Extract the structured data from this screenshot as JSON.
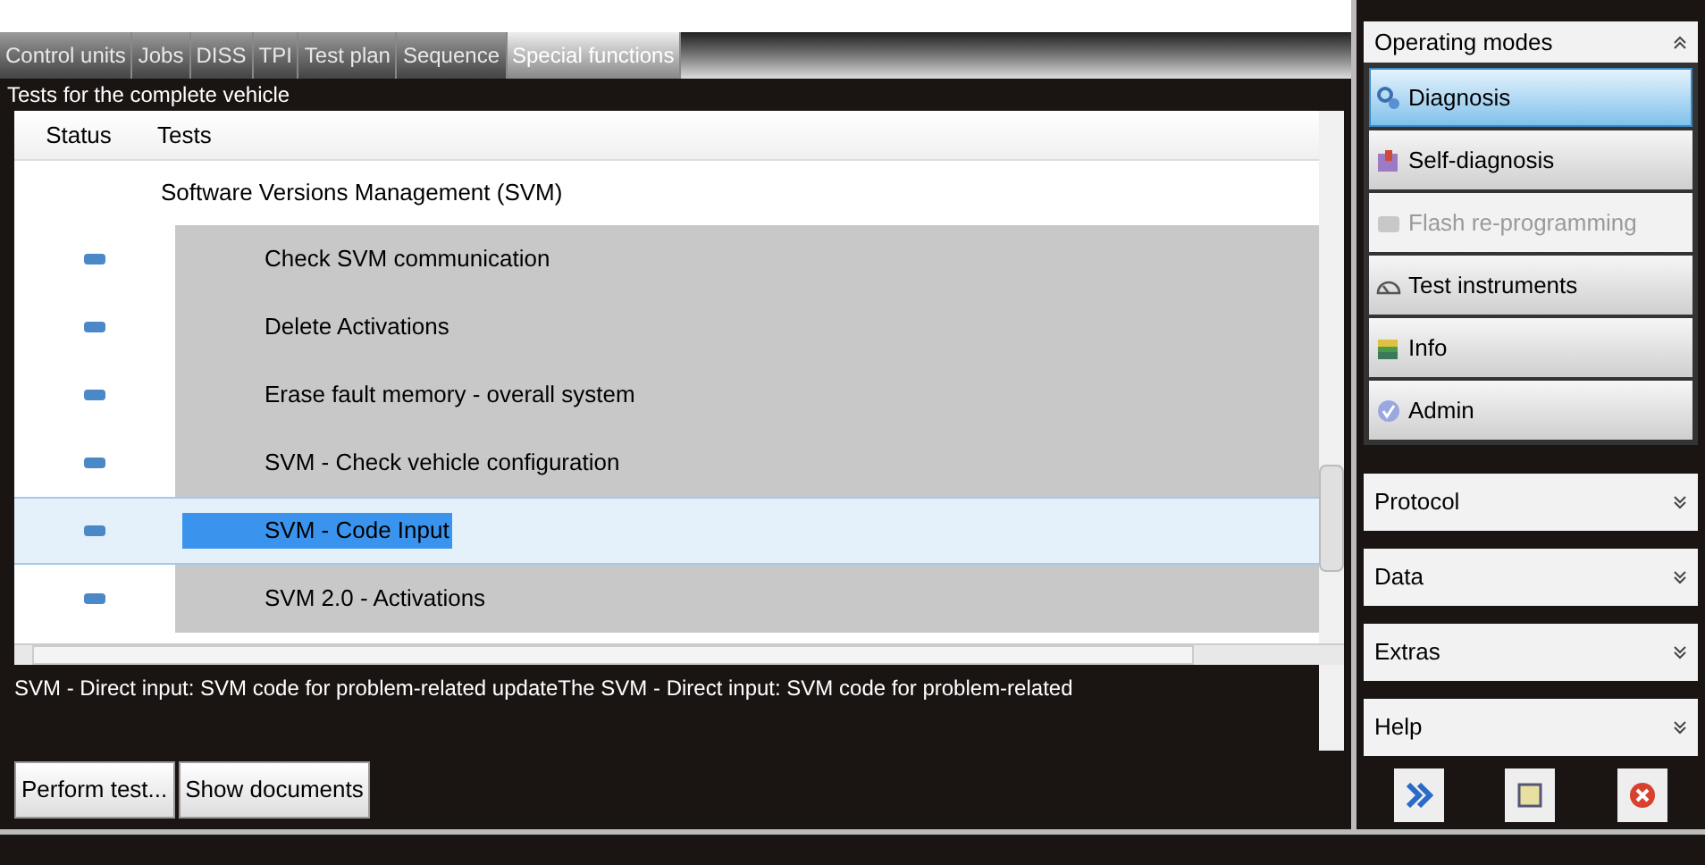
{
  "tabs": [
    {
      "label": "Control units",
      "selected": false
    },
    {
      "label": "Jobs",
      "selected": false
    },
    {
      "label": "DISS",
      "selected": false
    },
    {
      "label": "TPI",
      "selected": false
    },
    {
      "label": "Test plan",
      "selected": false
    },
    {
      "label": "Sequence",
      "selected": false
    },
    {
      "label": "Special functions",
      "selected": true
    }
  ],
  "section_title": "Tests for the complete vehicle",
  "table": {
    "columns": [
      "Status",
      "Tests"
    ],
    "group": "Software Versions Management (SVM)",
    "rows": [
      {
        "test": "Check SVM communication",
        "selected": false
      },
      {
        "test": "Delete Activations",
        "selected": false
      },
      {
        "test": "Erase fault memory - overall system",
        "selected": false
      },
      {
        "test": "SVM - Check vehicle configuration",
        "selected": false
      },
      {
        "test": "SVM - Code Input",
        "selected": true
      },
      {
        "test": "SVM 2.0 - Activations",
        "selected": false
      }
    ]
  },
  "description": "SVM - Direct input: SVM code for problem-related updateThe SVM - Direct input: SVM code for problem-related",
  "buttons": [
    "Perform test...",
    "Show documents"
  ],
  "sidebar": {
    "header": "Operating modes",
    "modes": [
      {
        "label": "Diagnosis",
        "kind": "stethoscope",
        "selected": true,
        "disabled": false
      },
      {
        "label": "Self-diagnosis",
        "kind": "car",
        "selected": false,
        "disabled": false
      },
      {
        "label": "Flash re-programming",
        "kind": "flash",
        "selected": false,
        "disabled": true
      },
      {
        "label": "Test instruments",
        "kind": "gauge",
        "selected": false,
        "disabled": false
      },
      {
        "label": "Info",
        "kind": "info",
        "selected": false,
        "disabled": false
      },
      {
        "label": "Admin",
        "kind": "admin",
        "selected": false,
        "disabled": false
      }
    ],
    "sections": [
      "Protocol",
      "Data",
      "Extras",
      "Help"
    ]
  }
}
